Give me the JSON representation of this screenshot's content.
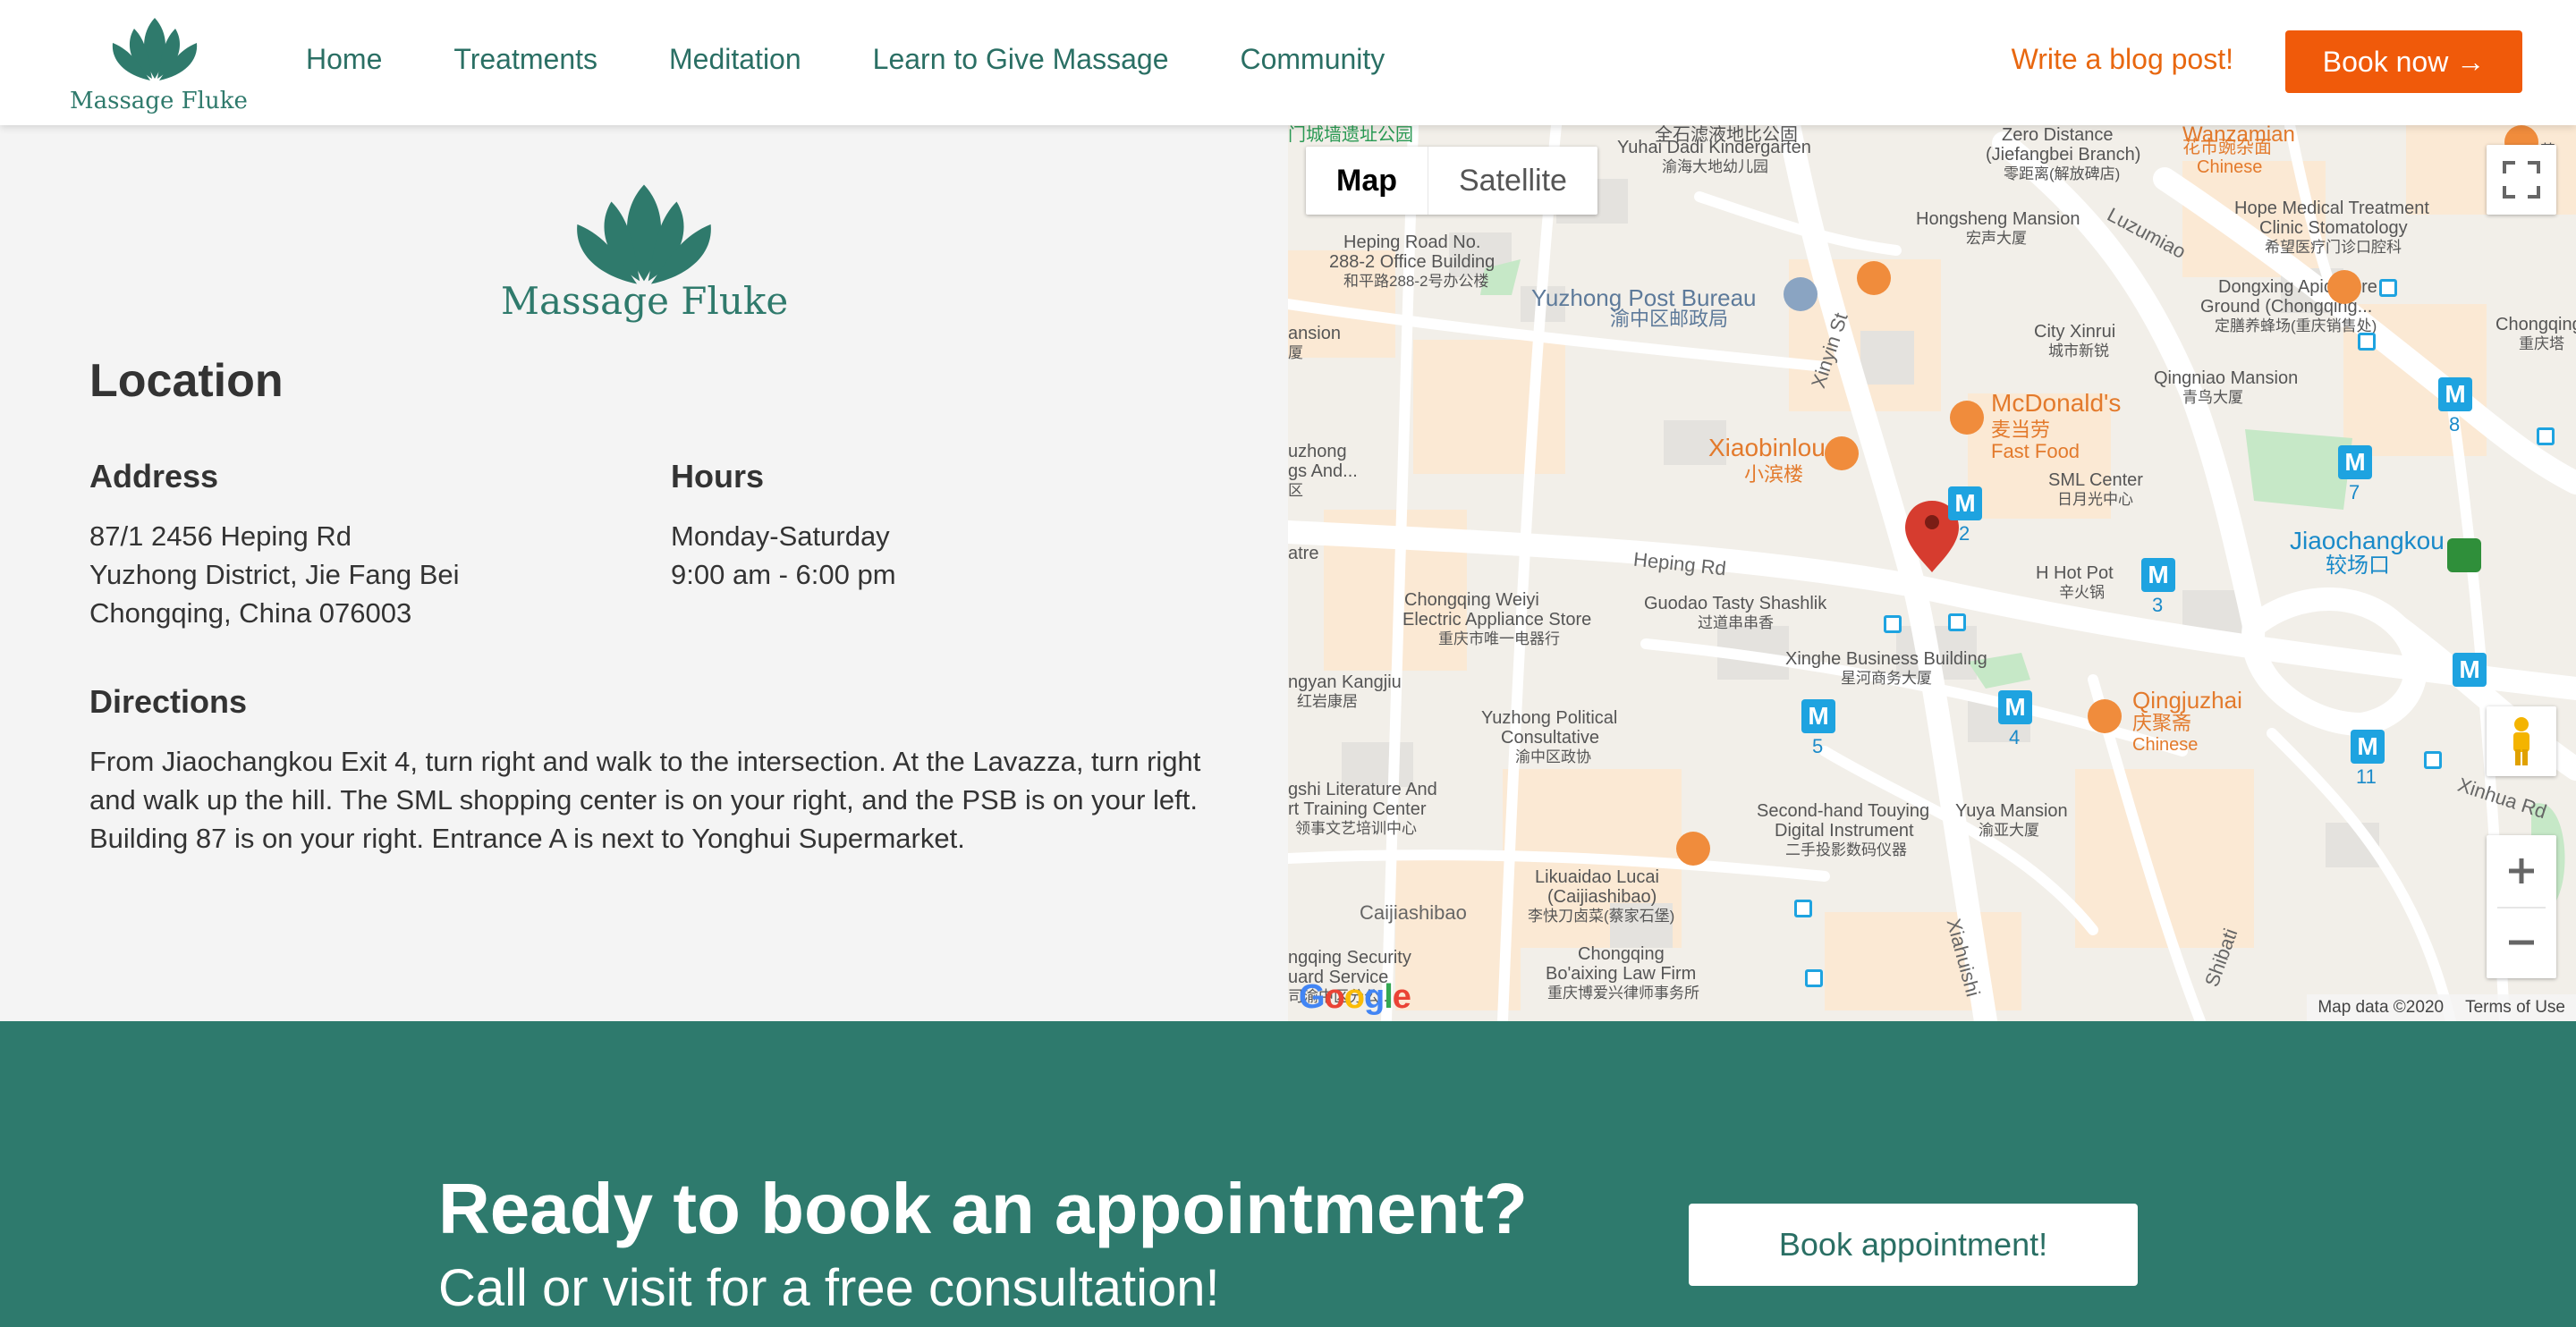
{
  "colors": {
    "brand_green": "#2f7a6c",
    "cta_bg": "#2e7a6d",
    "accent_orange": "#f05a0a",
    "blog_orange": "#e8670f",
    "map_pin": "#d63c2f"
  },
  "header": {
    "logo_text": "Massage Fluke",
    "nav": [
      "Home",
      "Treatments",
      "Meditation",
      "Learn to Give Massage",
      "Community"
    ],
    "blog_link": "Write a blog post!",
    "book_button": "Book now →"
  },
  "location": {
    "logo_text": "Massage Fluke",
    "title": "Location",
    "address_heading": "Address",
    "address_lines": [
      "87/1 2456 Heping Rd",
      "Yuzhong District, Jie Fang Bei",
      "Chongqing, China 076003"
    ],
    "hours_heading": "Hours",
    "hours_lines": [
      "Monday-Saturday",
      "9:00 am - 6:00 pm"
    ],
    "directions_heading": "Directions",
    "directions_text": "From Jiaochangkou Exit 4, turn right and walk to the intersection. At the Lavazza, turn right and walk up the hill. The SML shopping center is on your right, and the PSB is on your left. Building 87 is on your right. Entrance A is next to Yonghui Supermarket."
  },
  "map": {
    "type_map": "Map",
    "type_satellite": "Satellite",
    "footer_data": "Map data ©2020",
    "footer_terms": "Terms of Use",
    "google": "Google",
    "icons": {
      "fullscreen": "fullscreen-icon",
      "pegman": "pegman-icon",
      "zoom_in": "plus-icon",
      "zoom_out": "minus-icon",
      "pin": "map-pin-icon"
    },
    "labels": {
      "yuhai": "Yuhai Dadi Kindergarten",
      "yuhai_cn": "渝海大地幼儿园",
      "zero": "Zero Distance",
      "zero2": "(Jiefangbei Branch)",
      "zero_cn": "零距离(解放碑店)",
      "wanzamian": "Wanzamian",
      "wanzamian_cn": "花市豌杂面",
      "wanzamian_type": "Chinese",
      "hope": "Hope Medical Treatment",
      "hope2": "Clinic Stomatology",
      "hope_cn": "希望医疗门诊口腔科",
      "hongsheng": "Hongsheng Mansion",
      "hongsheng_cn": "宏声大厦",
      "luzumiao": "Luzumiao",
      "heping_bldg": "Heping Road No.",
      "heping_bldg2": "288-2 Office Building",
      "heping_bldg_cn": "和平路288-2号办公楼",
      "yuzhong_post": "Yuzhong Post Bureau",
      "yuzhong_post_cn": "渝中区邮政局",
      "chongqing_apic": "Dongxing Apiculture",
      "chongqing_apic2": "Ground (Chongqing...",
      "chongqing_apic_cn": "定膳养蜂场(重庆销售处)",
      "city_xinrui": "City Xinrui",
      "city_xinrui_cn": "城市新锐",
      "chongqing_pa": "Chongqing Pa",
      "chongqing_pa_cn": "重庆塔",
      "xinyin": "Xinyin St",
      "qingniao": "Qingniao Mansion",
      "qingniao_cn": "青鸟大厦",
      "mcdonalds": "McDonald's",
      "mcdonalds_cn": "麦当劳",
      "mcdonalds_type": "Fast Food",
      "xiaobinlou": "Xiaobinlou",
      "xiaobinlou_cn": "小滨楼",
      "sml": "SML Center",
      "sml_cn": "日月光中心",
      "jiaochangkou": "Jiaochangkou",
      "jiaochangkou_cn": "较场口",
      "heping_rd": "Heping Rd",
      "h_hot_pot": "H Hot Pot",
      "h_hot_pot_cn": "辛火锅",
      "weiyi": "Chongqing Weiyi",
      "weiyi2": "Electric Appliance Store",
      "weiyi_cn": "重庆市唯一电器行",
      "guodao": "Guodao Tasty Shashlik",
      "guodao_cn": "过道串串香",
      "xinghe": "Xinghe Business Building",
      "xinghe_cn": "星河商务大厦",
      "qingjuzhai": "Qingjuzhai",
      "qingjuzhai_cn": "庆聚斋",
      "qingjuzhai_type": "Chinese",
      "kangjiu": "ngyan Kangjiu",
      "kangjiu_cn": "红岩康居",
      "political": "Yuzhong Political",
      "political2": "Consultative",
      "political_cn": "渝中区政协",
      "xinhua": "Xinhua Rd",
      "literature": "gshi Literature And",
      "literature2": "rt Training Center",
      "literature_cn": "领事文艺培训中心",
      "touying": "Second-hand Touying",
      "touying2": "Digital Instrument",
      "touying_cn": "二手投影数码仪器",
      "yuya": "Yuya Mansion",
      "yuya_cn": "渝亚大厦",
      "likuaidao": "Likuaidao Lucai",
      "likuaidao2": "(Caijiashibao)",
      "likuaidao_cn": "李快刀卤菜(蔡家石堡)",
      "caijiashibao": "Caijiashibao",
      "security": "ngqing Security",
      "security2": "uard Service",
      "security_cn": "司渝中区分公...",
      "law": "Chongqing",
      "law2": "Bo'aixing Law Firm",
      "law_cn": "重庆博爱兴律师事务所",
      "xiahuishi": "Xiahuishi",
      "shibati": "Shibati",
      "left_ansion": "ansion",
      "left_ansion_cn": "厦",
      "left_uzhong": "uzhong",
      "left_uzhong2": "gs And...",
      "left_uzhong_cn": "区",
      "left_atre": "atre",
      "top_park": "门城墙遗址公园",
      "top_mid": "全石滤液地比公固",
      "top_right": "英"
    },
    "metro": [
      {
        "line": "2"
      },
      {
        "line": "8"
      },
      {
        "line": "7"
      },
      {
        "line": "3"
      },
      {
        "line": "5"
      },
      {
        "line": "4"
      },
      {
        "line": "11"
      }
    ]
  },
  "cta": {
    "title": "Ready to book an appointment?",
    "subtitle": "Call or visit for a free consultation!",
    "button": "Book appointment!"
  }
}
